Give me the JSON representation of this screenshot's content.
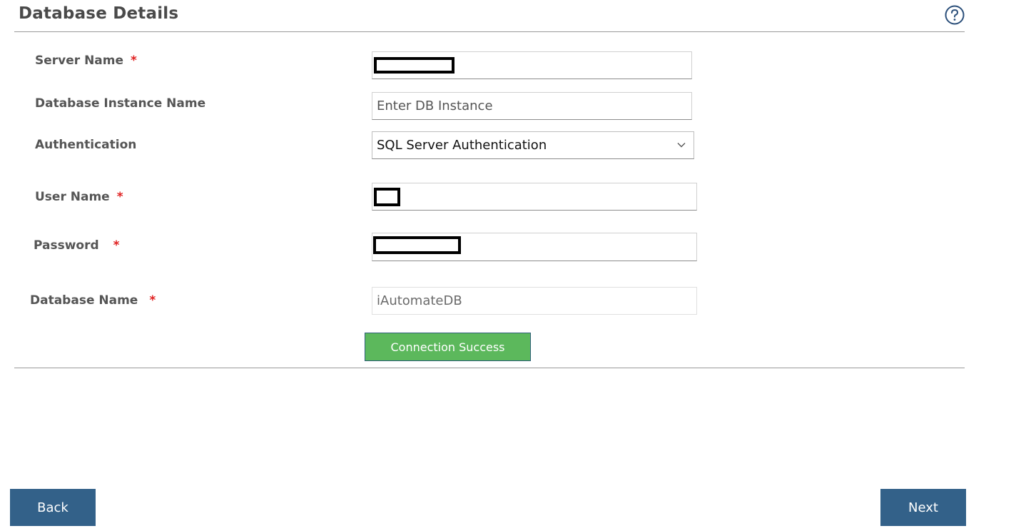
{
  "header": {
    "title": "Database Details",
    "help_icon": "question-circle-icon"
  },
  "form": {
    "server_name": {
      "label": "Server Name",
      "required_mark": "*",
      "value": ""
    },
    "db_instance": {
      "label": "Database Instance Name",
      "placeholder": "Enter DB Instance",
      "value": ""
    },
    "authentication": {
      "label": "Authentication",
      "selected": "SQL Server Authentication",
      "icon": "chevron-down-icon"
    },
    "user_name": {
      "label": "User Name",
      "required_mark": "*",
      "value": ""
    },
    "password": {
      "label": "Password",
      "required_mark": "*",
      "value": ""
    },
    "database_name": {
      "label": "Database Name",
      "required_mark": "*",
      "value": "iAutomateDB"
    }
  },
  "connection_button": {
    "label": "Connection Success",
    "color": "#5cb85c"
  },
  "footer": {
    "back_label": "Back",
    "next_label": "Next",
    "button_color": "#336189"
  }
}
